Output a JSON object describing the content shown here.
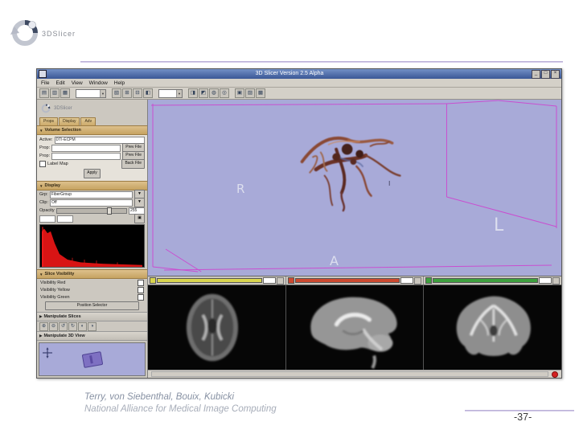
{
  "slide": {
    "logo_text": "3DSlicer",
    "footer_authors": "Terry, von Siebenthal, Bouix, Kubicki",
    "footer_affiliation": "National Alliance for Medical Image Computing",
    "page_number": "-37-"
  },
  "colors": {
    "titlebar_blue": "#3a5796",
    "viewport_lavender": "#a8aad8",
    "wireframe_magenta": "#cf3fcf",
    "slice_bar_yellow": "#d8d44e",
    "slice_bar_red": "#cc4a30",
    "slice_bar_green": "#3fa03f",
    "panel_gray": "#d4d0c8",
    "histogram_red": "#d81414"
  },
  "app": {
    "title": "3D Slicer Version 2.5 Alpha",
    "window_buttons": [
      "_",
      "□",
      "×"
    ],
    "menu": {
      "items": [
        "File",
        "Edit",
        "View",
        "Window",
        "Help"
      ]
    },
    "toolbar": {
      "icons": [
        "▤",
        "▥",
        "▦",
        "▧",
        "⊞",
        "⊟",
        "◧",
        "◨",
        "◩",
        "◍",
        "◎",
        "▣",
        "▨",
        "▩"
      ]
    },
    "panel": {
      "logo_text": "3DSlicer",
      "tabs": [
        "Props",
        "Display",
        "Adv"
      ],
      "section_volumes": "Volume Selection",
      "fields": [
        {
          "label": "Active:",
          "value": "DTI-ECPM"
        },
        {
          "label": "Prop:",
          "button": "Prev File"
        },
        {
          "label": "Prop:",
          "button": "Prev File"
        },
        {
          "label": "Label Map",
          "button": "Back File"
        }
      ],
      "apply_label": "Apply",
      "section_display": "Display",
      "row_group_label": "Grp:",
      "row_group_value": "FiberGroup",
      "row_clip_label": "Clip:",
      "row_clip_value": "Off",
      "opacity_label": "Opacity",
      "opacity_value": "255",
      "section_visibility": "Slice Visibility",
      "visibility": [
        {
          "label": "Visibility Red"
        },
        {
          "label": "Visibility Yellow"
        },
        {
          "label": "Visibility Green"
        }
      ],
      "selector_button": "Position Selector",
      "collapse_slices": "Manipulate Slices",
      "collapse_view": "Manipulate 3D View",
      "nav_icons": [
        "⊕",
        "⊖",
        "↺",
        "↻",
        "◐",
        "◑"
      ]
    },
    "viewport": {
      "marker_r": "R",
      "marker_i": "I",
      "marker_l": "L",
      "marker_a": "A"
    }
  }
}
